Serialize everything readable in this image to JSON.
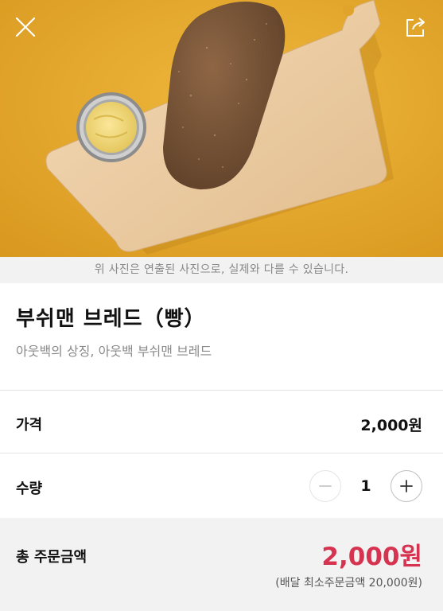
{
  "caption": "위 사진은 연출된 사진으로, 실제와 다를 수 있습니다.",
  "product": {
    "title": "부쉬맨 브레드（빵）",
    "description": "아웃백의 상징, 아웃백 부쉬맨 브레드"
  },
  "price": {
    "label": "가격",
    "value": "2,000원"
  },
  "quantity": {
    "label": "수량",
    "value": "1"
  },
  "total": {
    "label": "총 주문금액",
    "value": "2,000원",
    "min_order_note": "(배달 최소주문금액 20,000원)"
  },
  "icons": {
    "close": "close-icon",
    "share": "share-icon",
    "minus": "minus-icon",
    "plus": "plus-icon"
  },
  "colors": {
    "hero_background": "#e6a72c",
    "total_accent": "#d5334f",
    "caption_bar": "#f2f2f2"
  }
}
